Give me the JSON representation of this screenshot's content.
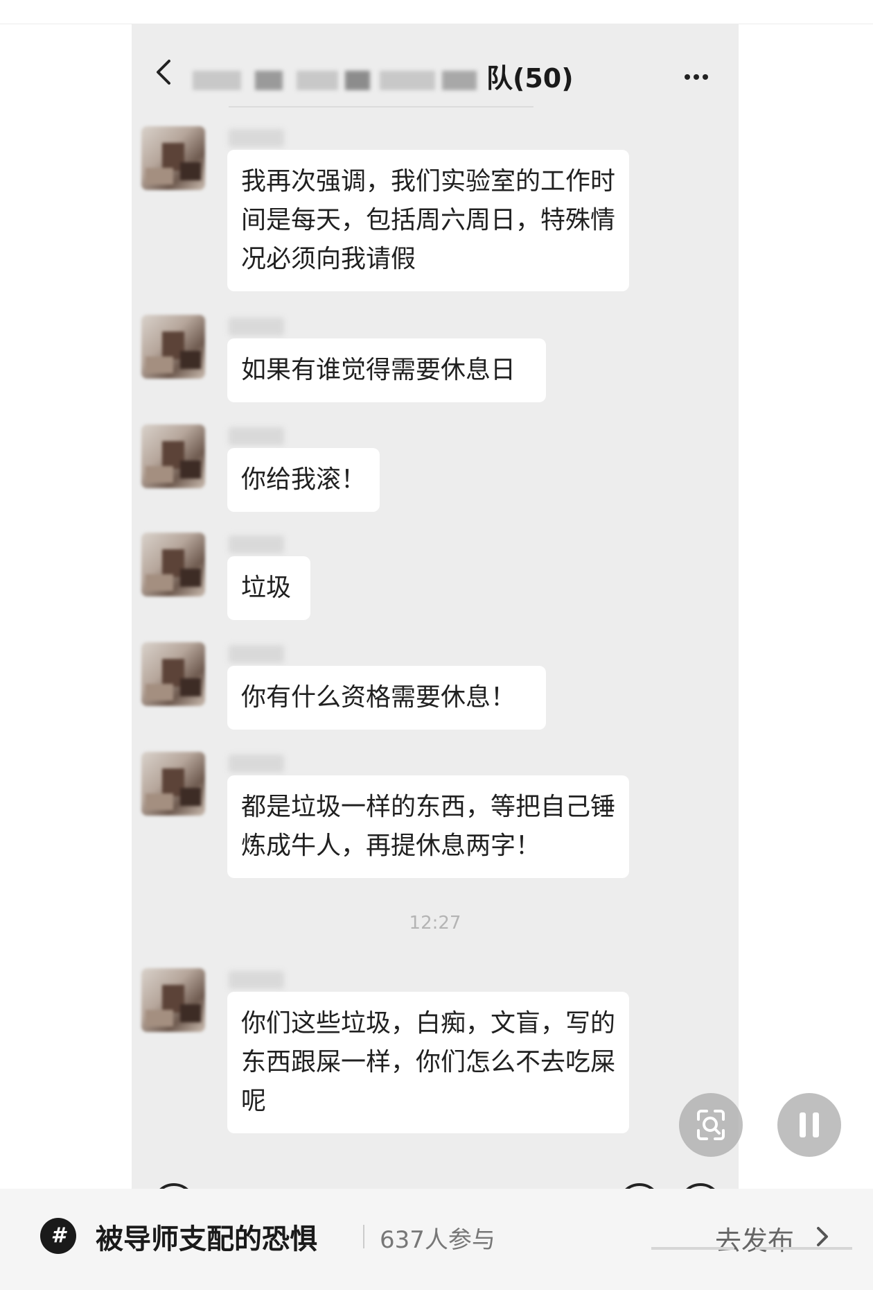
{
  "chat": {
    "group_title": "队(50)",
    "messages": [
      {
        "text": "我再次强调，我们实验室的工作时间是每天，包括周六周日，特殊情况必须向我请假"
      },
      {
        "text": "如果有谁觉得需要休息日"
      },
      {
        "text": "你给我滚！"
      },
      {
        "text": "垃圾"
      },
      {
        "text": "你有什么资格需要休息！"
      },
      {
        "text": "都是垃圾一样的东西，等把自己锤炼成牛人，再提休息两字！"
      },
      {
        "text": "你们这些垃圾，白痴，文盲，写的东西跟屎一样，你们怎么不去吃屎呢"
      }
    ],
    "timestamp": "12:27"
  },
  "bottom": {
    "topic_icon_glyph": "#",
    "topic_title": "被导师支配的恐惧",
    "participants": "637人参与",
    "publish_label": "去发布"
  },
  "icons": [
    "back-icon",
    "more-icon",
    "scan-icon",
    "pause-icon",
    "topic-hashtag-icon",
    "chevron-right-icon"
  ],
  "colors": {
    "chat_background": "#ededed",
    "bubble_background": "#ffffff",
    "bottom_bar_background": "#f5f5f5"
  }
}
